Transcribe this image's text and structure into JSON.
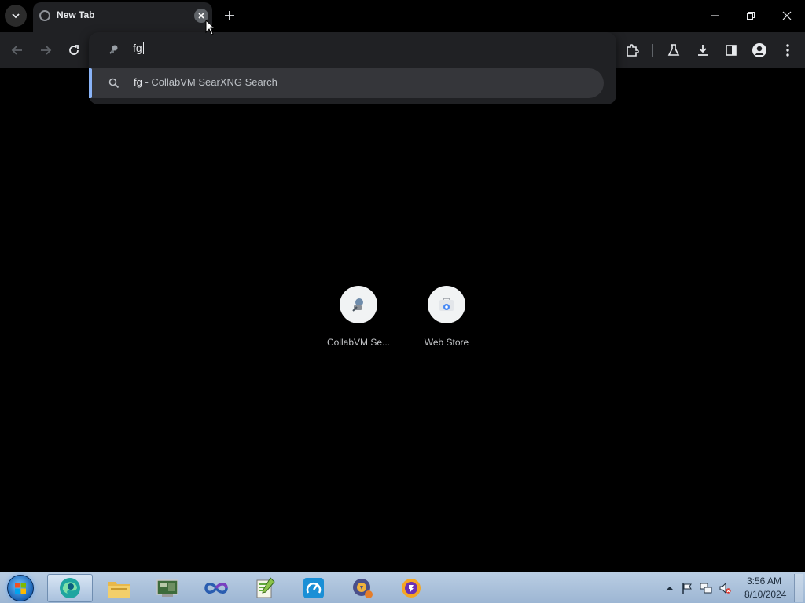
{
  "tab": {
    "title": "New Tab"
  },
  "omnibox": {
    "text": "fg"
  },
  "suggestion": {
    "query": "fg",
    "separator": " - ",
    "engine": "CollabVM SearXNG Search"
  },
  "shortcuts": [
    {
      "label": "CollabVM Se..."
    },
    {
      "label": "Web Store"
    }
  ],
  "clock": {
    "time": "3:56 AM",
    "date": "8/10/2024"
  },
  "colors": {
    "accent": "#8ab4f8",
    "toolbar": "#202124",
    "page": "#000000",
    "suggestion_bg": "#35363a"
  },
  "icons": {
    "toolbar": [
      "back-icon",
      "forward-icon",
      "reload-icon",
      "extensions-icon",
      "labs-icon",
      "download-icon",
      "side-panel-icon",
      "profile-icon",
      "menu-icon"
    ],
    "taskbar": [
      "start-orb",
      "edge-icon",
      "file-explorer-icon",
      "device-manager-icon",
      "infinity-app-icon",
      "notepad-plus-plus-icon",
      "speedtest-icon",
      "vpn-app-icon",
      "browser-icon"
    ],
    "tray": [
      "tray-expand-icon",
      "action-center-flag-icon",
      "network-icon",
      "volume-muted-icon"
    ]
  }
}
